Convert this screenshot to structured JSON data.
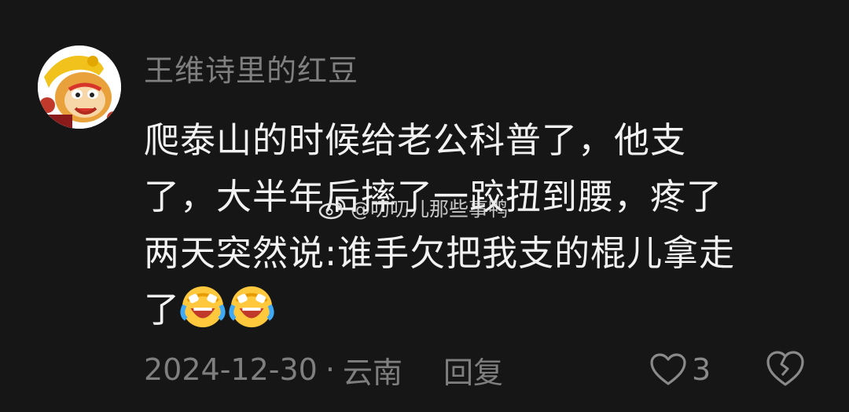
{
  "comment": {
    "username": "王维诗里的红豆",
    "text_line1": "爬泰山的时候给老公科普了，他支",
    "text_line2": "了，大半年后摔了一跤扭到腰，疼了",
    "text_line3": "两天突然说:谁手欠把我支的棍儿拿走",
    "text_line4": "了",
    "emojis": [
      "laughing-crying-emoji",
      "laughing-crying-emoji"
    ],
    "date": "2024-12-30",
    "separator": "·",
    "location": "云南",
    "reply_label": "回复",
    "like_count": "3"
  },
  "watermark": {
    "text": "@叨叨儿那些事鸭",
    "icon": "weibo-icon"
  },
  "colors": {
    "background": "#161616",
    "text": "#f2f2f2",
    "muted": "#7f7f7f",
    "emoji_face": "#ffc83d"
  },
  "icons": {
    "avatar": "monkey-king-avatar",
    "like": "heart-outline-icon",
    "dislike": "broken-heart-icon"
  }
}
